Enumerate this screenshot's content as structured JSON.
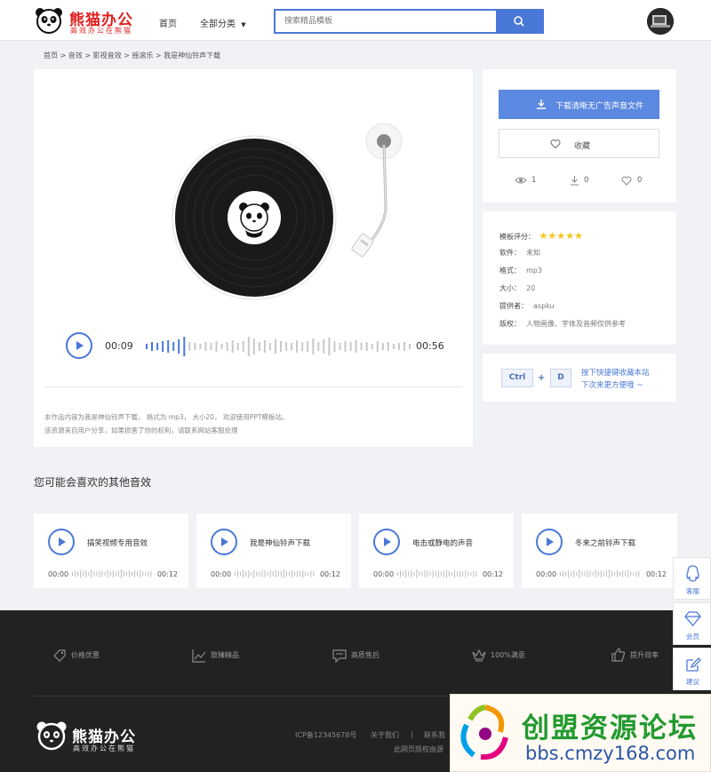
{
  "header": {
    "logo_title": "熊猫办公",
    "logo_slogan": "高效办公在熊猫",
    "nav_home": "首页",
    "nav_categories": "全部分类",
    "search_placeholder": "搜索精品模板"
  },
  "breadcrumb": "首页 > 音效 > 影视音效 > 摇滚乐 > 我是神仙铃声下载",
  "player": {
    "current_time": "00:09",
    "total_time": "00:56",
    "progress": 0.16,
    "description_line1": "本作品内容为我是神仙铃声下载， 格式为 mp3， 大小20， 欢迎使用PPT模板站。",
    "description_line2": "该资源来自用户分享，如果损害了你的权利，请联系网站客服处理"
  },
  "download": {
    "download_label": "下载清晰无广告声音文件",
    "favorite_label": "收藏",
    "views": "1",
    "downloads": "0",
    "likes": "0"
  },
  "info": {
    "rating_label": "模板评分：",
    "rating_stars": 5,
    "software_label": "软件：",
    "software_value": "未知",
    "format_label": "格式：",
    "format_value": "mp3",
    "size_label": "大小：",
    "size_value": "20",
    "provider_label": "提供者：",
    "provider_value": "aspku",
    "copyright_label": "版权：",
    "copyright_value": "人物画像、字体及音频仅供参考"
  },
  "shortcut": {
    "key1": "Ctrl",
    "plus": "+",
    "key2": "D",
    "line1": "按下快捷键收藏本站",
    "line2": "下次来更方便哦 ~"
  },
  "related": {
    "heading": "您可能会喜欢的其他音效",
    "items": [
      {
        "title": "搞笑视频专用音效",
        "start": "00:00",
        "end": "00:12"
      },
      {
        "title": "我是神仙铃声下载",
        "start": "00:00",
        "end": "00:12"
      },
      {
        "title": "电击或静电的声音",
        "start": "00:00",
        "end": "00:12"
      },
      {
        "title": "冬来之前铃声下载",
        "start": "00:00",
        "end": "00:12"
      }
    ]
  },
  "sidebar": {
    "service": "客服",
    "member": "会员",
    "suggest": "建议"
  },
  "footer": {
    "features": [
      "价格优惠",
      "致臻精品",
      "高质售后",
      "100%满意",
      "提升效率"
    ],
    "logo_title": "熊猫办公",
    "logo_slogan": "高效办公在熊猫",
    "icp": "ICP备12345678号",
    "about": "关于我们",
    "separator": "|",
    "contact": "联系我",
    "copyright_partial": "此网页版权由源"
  },
  "watermark": {
    "title": "创盟资源论坛",
    "url": "bbs.cmzy168.com"
  },
  "colors": {
    "accent": "#4a78d8",
    "brand_red": "#e02020",
    "star": "#f5c518",
    "footer_bg": "#222222"
  }
}
